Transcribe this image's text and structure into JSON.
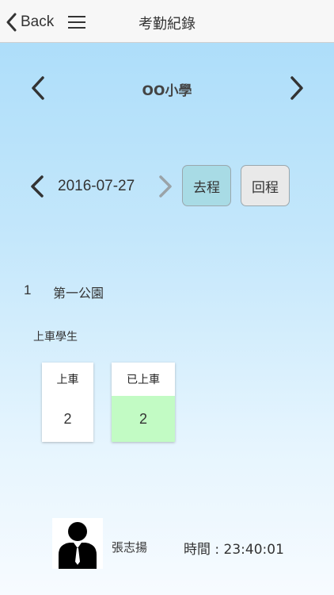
{
  "navbar": {
    "back_label": "Back",
    "title": "考勤紀錄"
  },
  "school": {
    "name": "OO小學"
  },
  "date_picker": {
    "date": "2016-07-27"
  },
  "trip_buttons": {
    "outbound_label": "去程",
    "return_label": "回程",
    "selected": "去程"
  },
  "stop": {
    "number": "1",
    "name": "第一公園"
  },
  "students": {
    "section_label": "上車學生",
    "boarding": {
      "label": "上車",
      "count": "2"
    },
    "boarded": {
      "label": "已上車",
      "count": "2"
    }
  },
  "driver": {
    "name": "張志揚",
    "time_label": "時間 : 23:40:01"
  },
  "colors": {
    "selected_trip": "#a8dbe5",
    "boarded_highlight": "#c2fbc4",
    "background_top": "#a9dcf9"
  }
}
